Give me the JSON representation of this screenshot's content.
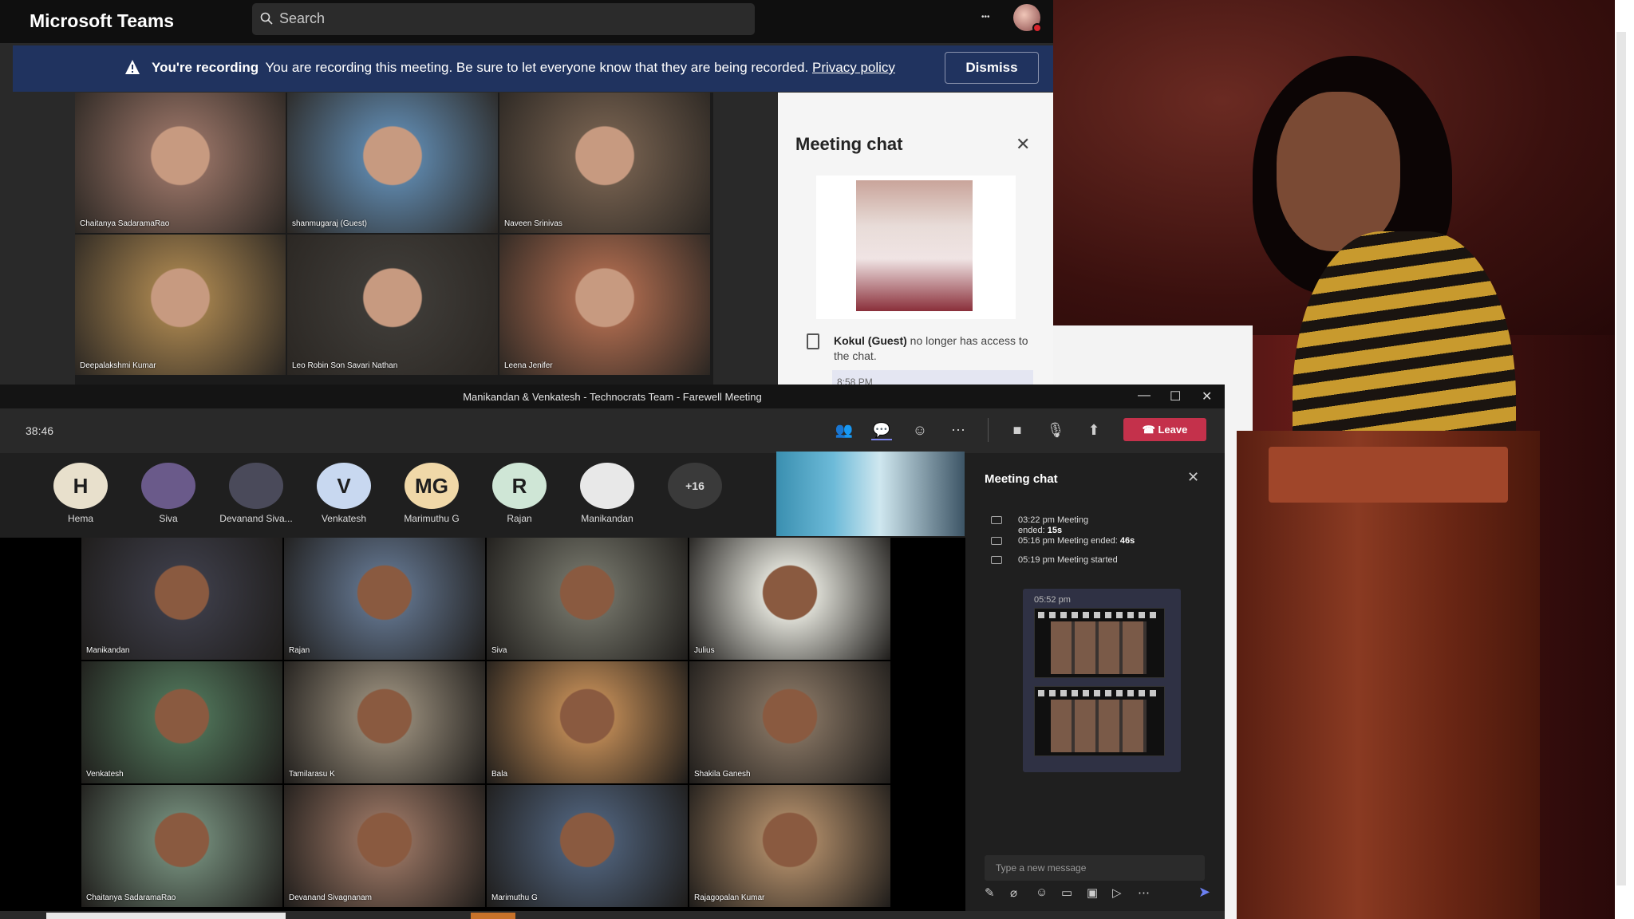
{
  "top_window": {
    "app_name": "Microsoft Teams",
    "search_placeholder": "Search",
    "more": "•••",
    "banner": {
      "label": "You're recording",
      "message": "You are recording this meeting. Be sure to let everyone know that they are being recorded.",
      "link": "Privacy policy",
      "dismiss": "Dismiss"
    },
    "participants": [
      {
        "name": "Chaitanya SadaramaRao",
        "color": "#8b6a5e"
      },
      {
        "name": "shanmugaraj (Guest)",
        "color": "#5a7fa0"
      },
      {
        "name": "Naveen Srinivas",
        "color": "#6d5a4a"
      },
      {
        "name": "Deepalakshmi Kumar",
        "color": "#9a7a4a"
      },
      {
        "name": "Leo Robin Son  Savari Nathan",
        "color": "#3d3a36"
      },
      {
        "name": "Leena Jenifer",
        "color": "#a0644a"
      }
    ],
    "chat": {
      "title": "Meeting chat",
      "system_name": "Kokul (Guest)",
      "system_text": "no longer has access to the chat.",
      "time": "8:58 PM"
    }
  },
  "bottom_window": {
    "title": "Manikandan & Venkatesh - Technocrats Team - Farewell Meeting",
    "timer": "38:46",
    "leave": "Leave",
    "avatars": [
      {
        "initials": "H",
        "name": "Hema",
        "bg": "#e8e0cc"
      },
      {
        "initials": "",
        "name": "Siva",
        "bg": "#6a5a8a"
      },
      {
        "initials": "",
        "name": "Devanand Siva...",
        "bg": "#4a4a5a"
      },
      {
        "initials": "V",
        "name": "Venkatesh",
        "bg": "#c8d8f0"
      },
      {
        "initials": "MG",
        "name": "Marimuthu G",
        "bg": "#f0d8a8"
      },
      {
        "initials": "R",
        "name": "Rajan",
        "bg": "#cfe6d6"
      },
      {
        "initials": "",
        "name": "Manikandan",
        "bg": "#e8e8e8"
      },
      {
        "initials": "+16",
        "name": "",
        "bg": "#3a3a3a"
      }
    ],
    "participants": [
      {
        "name": "Manikandan",
        "color": "#3a3a44"
      },
      {
        "name": "Rajan",
        "color": "#5a6a80"
      },
      {
        "name": "Siva",
        "color": "#6a6a60"
      },
      {
        "name": "Julius",
        "color": "#d8d8d0"
      },
      {
        "name": "Venkatesh",
        "color": "#4a6a52"
      },
      {
        "name": "Tamilarasu K",
        "color": "#8a8070"
      },
      {
        "name": "Bala",
        "color": "#b08050"
      },
      {
        "name": "Shakila Ganesh",
        "color": "#7a6a5a"
      },
      {
        "name": "Chaitanya SadaramaRao",
        "color": "#6a8070"
      },
      {
        "name": "Devanand Sivagnanam",
        "color": "#8a6a5a"
      },
      {
        "name": "Marimuthu G",
        "color": "#4a5a70"
      },
      {
        "name": "Rajagopalan Kumar",
        "color": "#a08060"
      }
    ],
    "chat": {
      "title": "Meeting chat",
      "events": [
        {
          "time": "03:22 pm",
          "text": "Meeting",
          "text2": "ended:",
          "bold": "15s"
        },
        {
          "time": "05:16 pm",
          "text": "Meeting ended:",
          "text2": "",
          "bold": "46s"
        },
        {
          "time": "05:19 pm",
          "text": "Meeting started",
          "text2": "",
          "bold": ""
        }
      ],
      "message_time": "05:52 pm",
      "compose_placeholder": "Type a new message"
    }
  },
  "colors": {
    "leave": "#c4314b",
    "banner": "#20335f",
    "accent": "#6b7ff0"
  }
}
